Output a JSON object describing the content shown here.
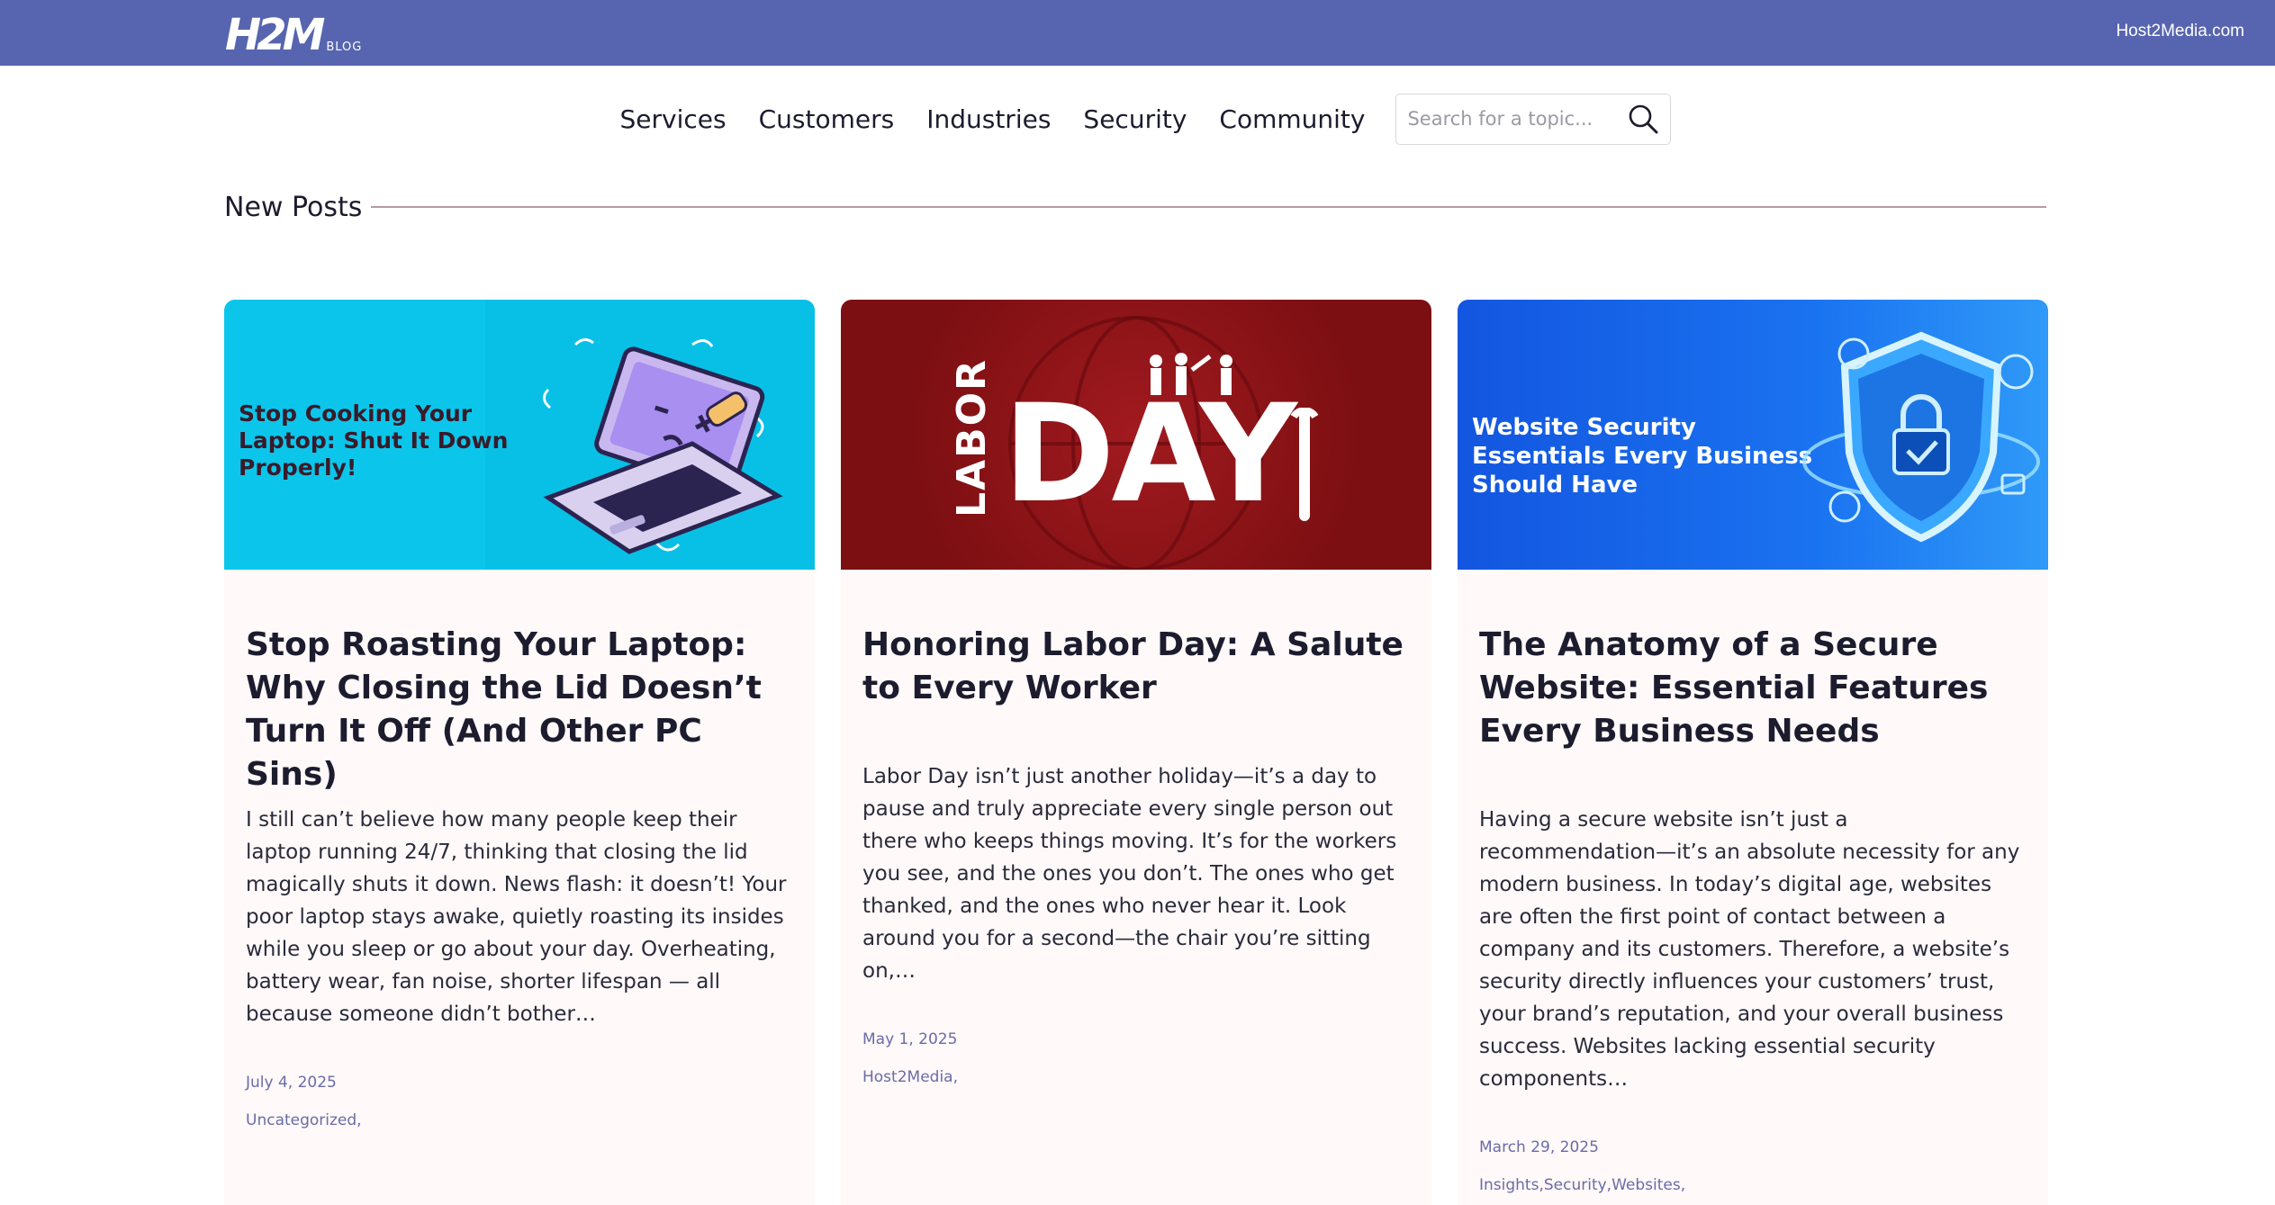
{
  "brand": {
    "logo_text": "H2M",
    "logo_subtext": "BLOG",
    "site_link": "Host2Media.com"
  },
  "nav": {
    "items": [
      {
        "label": "Services"
      },
      {
        "label": "Customers"
      },
      {
        "label": "Industries"
      },
      {
        "label": "Security"
      },
      {
        "label": "Community"
      }
    ],
    "search": {
      "placeholder": "Search for a topic...",
      "value": "",
      "icon": "search-icon"
    }
  },
  "section": {
    "title": "New Posts"
  },
  "posts": [
    {
      "image_caption": "Stop Cooking Your Laptop: Shut It Down Properly!",
      "title": "Stop Roasting Your Laptop: Why Closing the Lid Doesn’t Turn It Off (And Other PC Sins)",
      "excerpt": "I still can’t believe how many people keep their laptop running 24/7, thinking that closing the lid magically shuts it down. News flash: it doesn’t! Your poor laptop stays awake, quietly roasting its insides while you sleep or go about your day. Overheating, battery wear, fan noise, shorter lifespan — all because someone didn’t bother…",
      "date": "July 4, 2025",
      "categories": [
        "Uncategorized,"
      ]
    },
    {
      "image_caption": "LABOR DAY",
      "image_caption_parts": [
        "LABOR",
        "DAY"
      ],
      "title": "Honoring Labor Day: A Salute to Every Worker",
      "excerpt": "Labor Day isn’t just another holiday—it’s a day to pause and truly appreciate every single person out there who keeps things moving. It’s for the workers you see, and the ones you don’t. The ones who get thanked, and the ones who never hear it. Look around you for a second—the chair you’re sitting on,…",
      "date": "May 1, 2025",
      "categories": [
        "Host2Media,"
      ]
    },
    {
      "image_caption": "Website Security Essentials Every Business Should Have",
      "title": "The Anatomy of a Secure Website: Essential Features Every Business Needs",
      "excerpt": "Having a secure website isn’t just a recommendation—it’s an absolute necessity for any modern business. In today’s digital age, websites are often the first point of contact between a company and its customers. Therefore, a website’s security directly influences your customers’ trust, your brand’s reputation, and your overall business success. Websites lacking essential security components…",
      "date": "March 29, 2025",
      "categories": [
        "Insights,",
        "Security,",
        "Websites,"
      ]
    }
  ],
  "colors": {
    "topbar": "#5765b0",
    "card_bg": "#fff9f9",
    "meta": "#6b6ba8",
    "rule": "#b59aa5"
  }
}
